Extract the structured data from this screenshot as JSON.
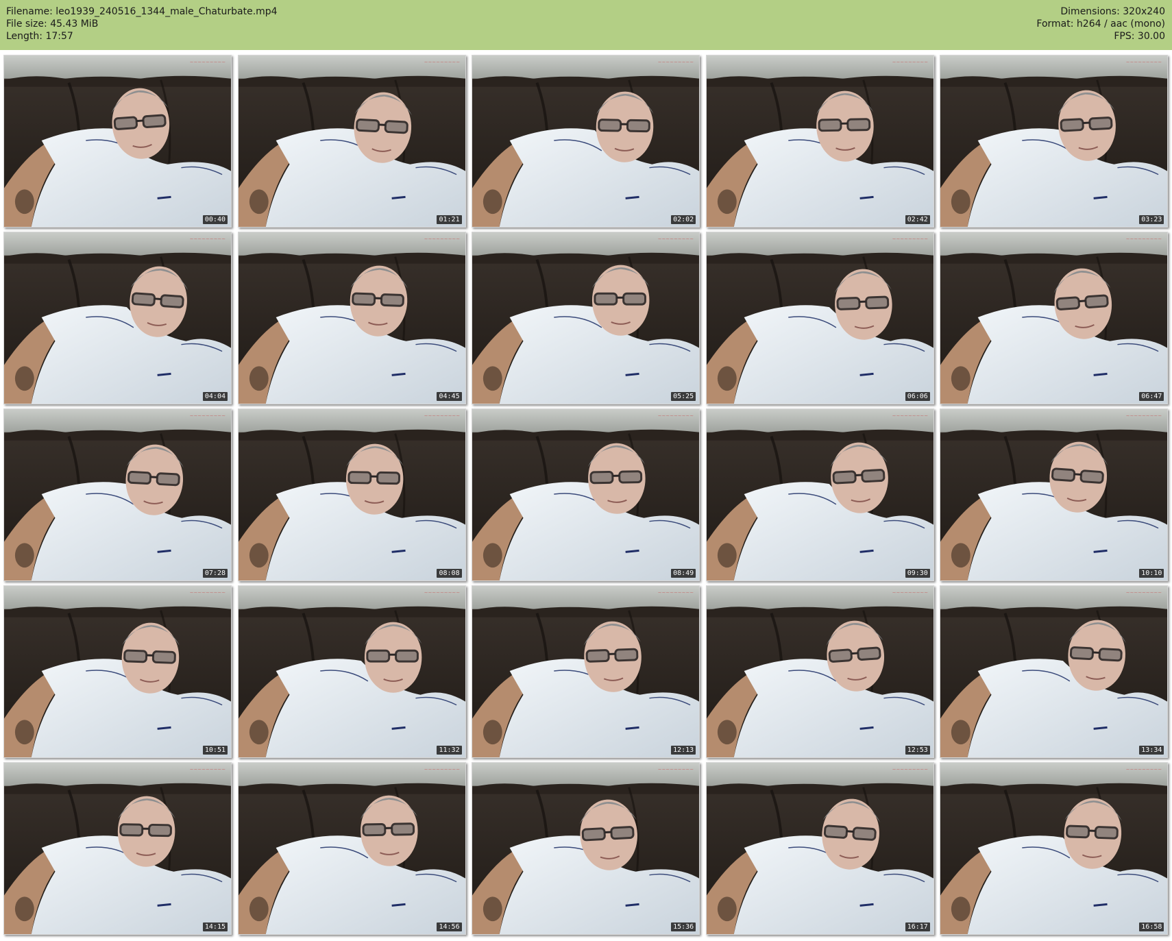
{
  "header": {
    "filename": "Filename: leo1939_240516_1344_male_Chaturbate.mp4",
    "filesize": "File size: 45.43 MiB",
    "length": "Length: 17:57",
    "dimensions": "Dimensions: 320x240",
    "format": "Format: h264 / aac (mono)",
    "fps": "FPS: 30.00"
  },
  "thumbnails": [
    {
      "timestamp": "00:40"
    },
    {
      "timestamp": "01:21"
    },
    {
      "timestamp": "02:02"
    },
    {
      "timestamp": "02:42"
    },
    {
      "timestamp": "03:23"
    },
    {
      "timestamp": "04:04"
    },
    {
      "timestamp": "04:45"
    },
    {
      "timestamp": "05:25"
    },
    {
      "timestamp": "06:06"
    },
    {
      "timestamp": "06:47"
    },
    {
      "timestamp": "07:28"
    },
    {
      "timestamp": "08:08"
    },
    {
      "timestamp": "08:49"
    },
    {
      "timestamp": "09:30"
    },
    {
      "timestamp": "10:10"
    },
    {
      "timestamp": "10:51"
    },
    {
      "timestamp": "11:32"
    },
    {
      "timestamp": "12:13"
    },
    {
      "timestamp": "12:53"
    },
    {
      "timestamp": "13:34"
    },
    {
      "timestamp": "14:15"
    },
    {
      "timestamp": "14:56"
    },
    {
      "timestamp": "15:36"
    },
    {
      "timestamp": "16:17"
    },
    {
      "timestamp": "16:58"
    }
  ],
  "colors": {
    "header_bg": "#b3cf85",
    "page_bg": "#ffffff"
  }
}
